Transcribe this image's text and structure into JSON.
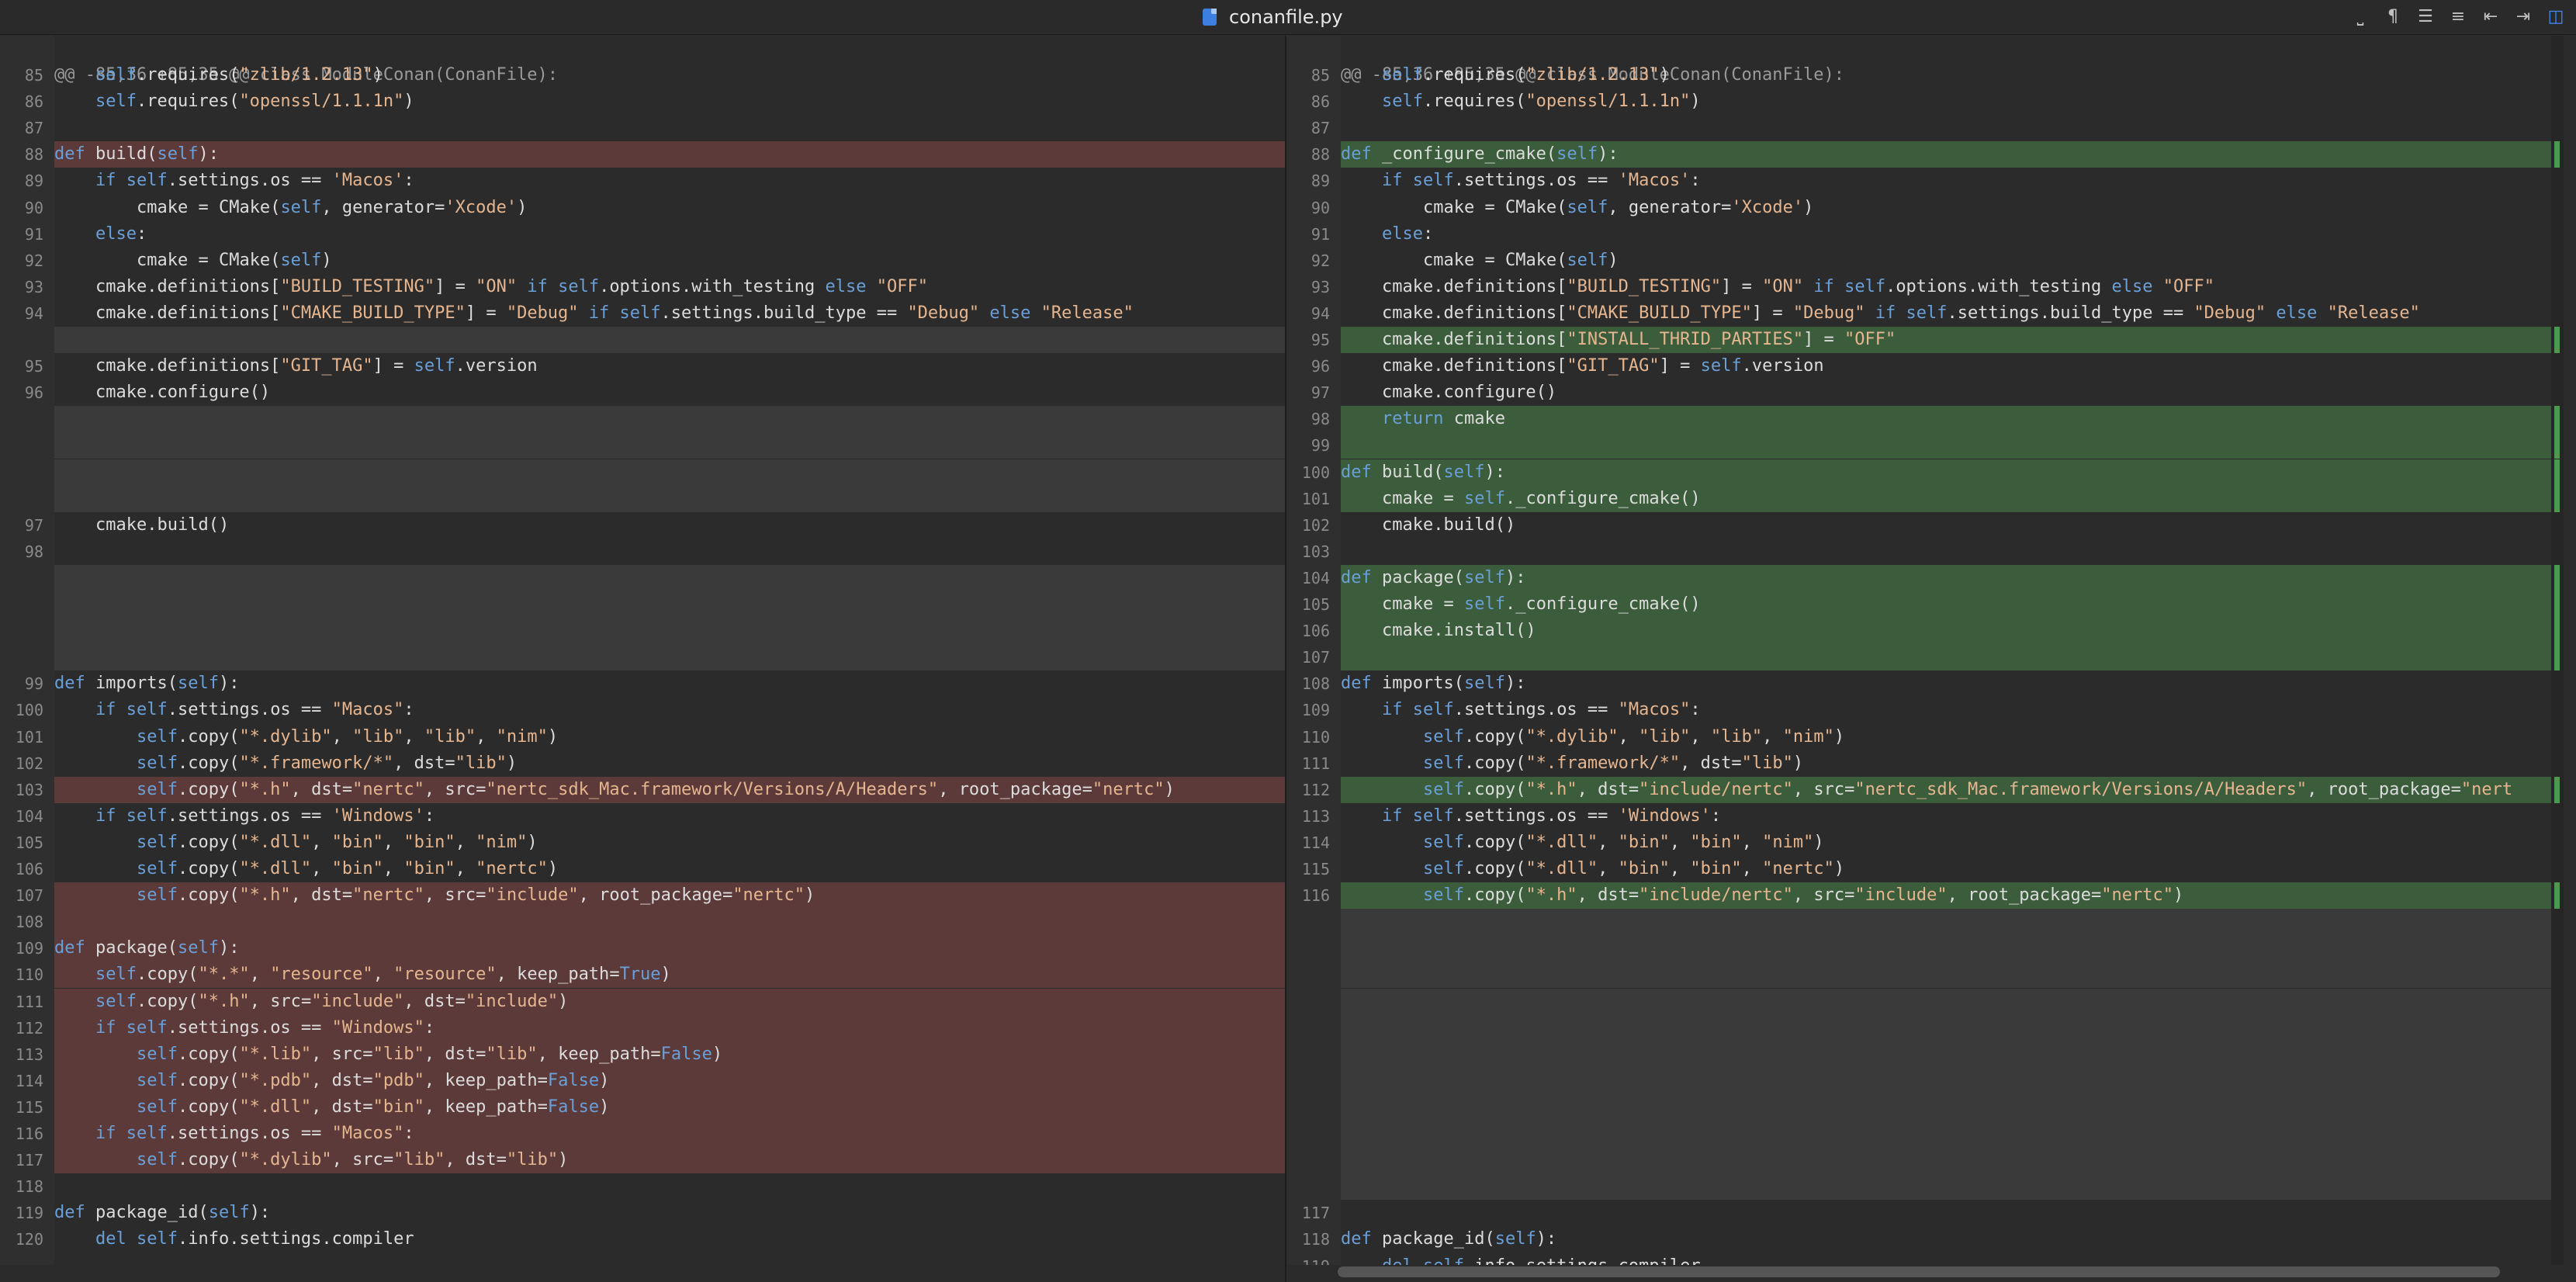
{
  "window": {
    "title": "conanfile.py",
    "file_icon": "python-file-icon"
  },
  "toolbar": {
    "icons": [
      "whitespace-icon",
      "pilcrow-icon",
      "align-left-icon",
      "align-center-icon",
      "indent-left-icon",
      "indent-right-icon",
      "split-view-icon"
    ],
    "glyphs": [
      "⎵",
      "¶",
      "☰",
      "≡",
      "⇤",
      "⇥",
      "◫"
    ]
  },
  "left": {
    "header": "@@ -85,36 +85,35 @@ class ModuleConan(ConanFile):",
    "rows": [
      {
        "ln": "85",
        "type": "",
        "text": "    self.requires(\"zlib/1.2.13\")"
      },
      {
        "ln": "86",
        "type": "",
        "text": "    self.requires(\"openssl/1.1.1n\")"
      },
      {
        "ln": "87",
        "type": "",
        "text": ""
      },
      {
        "ln": "88",
        "type": "del",
        "text": "def build(self):"
      },
      {
        "ln": "89",
        "type": "",
        "text": "    if self.settings.os == 'Macos':"
      },
      {
        "ln": "90",
        "type": "",
        "text": "        cmake = CMake(self, generator='Xcode')"
      },
      {
        "ln": "91",
        "type": "",
        "text": "    else:"
      },
      {
        "ln": "92",
        "type": "",
        "text": "        cmake = CMake(self)"
      },
      {
        "ln": "93",
        "type": "",
        "text": "    cmake.definitions[\"BUILD_TESTING\"] = \"ON\" if self.options.with_testing else \"OFF\""
      },
      {
        "ln": "94",
        "type": "",
        "text": "    cmake.definitions[\"CMAKE_BUILD_TYPE\"] = \"Debug\" if self.settings.build_type == \"Debug\" else \"Release\""
      },
      {
        "ln": "",
        "type": "empty",
        "text": ""
      },
      {
        "ln": "95",
        "type": "",
        "text": "    cmake.definitions[\"GIT_TAG\"] = self.version"
      },
      {
        "ln": "96",
        "type": "",
        "text": "    cmake.configure()"
      },
      {
        "ln": "",
        "type": "empty",
        "text": ""
      },
      {
        "ln": "",
        "type": "empty",
        "text": ""
      },
      {
        "ln": "",
        "type": "empty",
        "text": ""
      },
      {
        "ln": "",
        "type": "empty",
        "text": ""
      },
      {
        "ln": "97",
        "type": "",
        "text": "    cmake.build()"
      },
      {
        "ln": "98",
        "type": "",
        "text": ""
      },
      {
        "ln": "",
        "type": "empty",
        "text": ""
      },
      {
        "ln": "",
        "type": "empty",
        "text": ""
      },
      {
        "ln": "",
        "type": "empty",
        "text": ""
      },
      {
        "ln": "",
        "type": "empty",
        "text": ""
      },
      {
        "ln": "99",
        "type": "",
        "text": "def imports(self):"
      },
      {
        "ln": "100",
        "type": "",
        "text": "    if self.settings.os == \"Macos\":"
      },
      {
        "ln": "101",
        "type": "",
        "text": "        self.copy(\"*.dylib\", \"lib\", \"lib\", \"nim\")"
      },
      {
        "ln": "102",
        "type": "",
        "text": "        self.copy(\"*.framework/*\", dst=\"lib\")"
      },
      {
        "ln": "103",
        "type": "del",
        "text": "        self.copy(\"*.h\", dst=\"nertc\", src=\"nertc_sdk_Mac.framework/Versions/A/Headers\", root_package=\"nertc\")"
      },
      {
        "ln": "104",
        "type": "",
        "text": "    if self.settings.os == 'Windows':"
      },
      {
        "ln": "105",
        "type": "",
        "text": "        self.copy(\"*.dll\", \"bin\", \"bin\", \"nim\")"
      },
      {
        "ln": "106",
        "type": "",
        "text": "        self.copy(\"*.dll\", \"bin\", \"bin\", \"nertc\")"
      },
      {
        "ln": "107",
        "type": "del",
        "text": "        self.copy(\"*.h\", dst=\"nertc\", src=\"include\", root_package=\"nertc\")"
      },
      {
        "ln": "108",
        "type": "del",
        "text": ""
      },
      {
        "ln": "109",
        "type": "del",
        "text": "def package(self):"
      },
      {
        "ln": "110",
        "type": "del",
        "text": "    self.copy(\"*.*\", \"resource\", \"resource\", keep_path=True)"
      },
      {
        "ln": "111",
        "type": "del",
        "text": "    self.copy(\"*.h\", src=\"include\", dst=\"include\")"
      },
      {
        "ln": "112",
        "type": "del",
        "text": "    if self.settings.os == \"Windows\":"
      },
      {
        "ln": "113",
        "type": "del",
        "text": "        self.copy(\"*.lib\", src=\"lib\", dst=\"lib\", keep_path=False)"
      },
      {
        "ln": "114",
        "type": "del",
        "text": "        self.copy(\"*.pdb\", dst=\"pdb\", keep_path=False)"
      },
      {
        "ln": "115",
        "type": "del",
        "text": "        self.copy(\"*.dll\", dst=\"bin\", keep_path=False)"
      },
      {
        "ln": "116",
        "type": "del",
        "text": "    if self.settings.os == \"Macos\":"
      },
      {
        "ln": "117",
        "type": "del",
        "text": "        self.copy(\"*.dylib\", src=\"lib\", dst=\"lib\")"
      },
      {
        "ln": "118",
        "type": "",
        "text": ""
      },
      {
        "ln": "119",
        "type": "",
        "text": "def package_id(self):"
      },
      {
        "ln": "120",
        "type": "",
        "text": "    del self.info.settings.compiler"
      }
    ]
  },
  "right": {
    "header": "@@ -85,36 +85,35 @@ class ModuleConan(ConanFile):",
    "rows": [
      {
        "ln": "85",
        "type": "",
        "text": "    self.requires(\"zlib/1.2.13\")"
      },
      {
        "ln": "86",
        "type": "",
        "text": "    self.requires(\"openssl/1.1.1n\")"
      },
      {
        "ln": "87",
        "type": "",
        "text": ""
      },
      {
        "ln": "88",
        "type": "add",
        "text": "def _configure_cmake(self):"
      },
      {
        "ln": "89",
        "type": "",
        "text": "    if self.settings.os == 'Macos':"
      },
      {
        "ln": "90",
        "type": "",
        "text": "        cmake = CMake(self, generator='Xcode')"
      },
      {
        "ln": "91",
        "type": "",
        "text": "    else:"
      },
      {
        "ln": "92",
        "type": "",
        "text": "        cmake = CMake(self)"
      },
      {
        "ln": "93",
        "type": "",
        "text": "    cmake.definitions[\"BUILD_TESTING\"] = \"ON\" if self.options.with_testing else \"OFF\""
      },
      {
        "ln": "94",
        "type": "",
        "text": "    cmake.definitions[\"CMAKE_BUILD_TYPE\"] = \"Debug\" if self.settings.build_type == \"Debug\" else \"Release\""
      },
      {
        "ln": "95",
        "type": "add",
        "text": "    cmake.definitions[\"INSTALL_THRID_PARTIES\"] = \"OFF\""
      },
      {
        "ln": "96",
        "type": "",
        "text": "    cmake.definitions[\"GIT_TAG\"] = self.version"
      },
      {
        "ln": "97",
        "type": "",
        "text": "    cmake.configure()"
      },
      {
        "ln": "98",
        "type": "add",
        "text": "    return cmake"
      },
      {
        "ln": "99",
        "type": "add",
        "text": ""
      },
      {
        "ln": "100",
        "type": "add",
        "text": "def build(self):"
      },
      {
        "ln": "101",
        "type": "add",
        "text": "    cmake = self._configure_cmake()"
      },
      {
        "ln": "102",
        "type": "",
        "text": "    cmake.build()"
      },
      {
        "ln": "103",
        "type": "",
        "text": ""
      },
      {
        "ln": "104",
        "type": "add",
        "text": "def package(self):"
      },
      {
        "ln": "105",
        "type": "add",
        "text": "    cmake = self._configure_cmake()"
      },
      {
        "ln": "106",
        "type": "add",
        "text": "    cmake.install()"
      },
      {
        "ln": "107",
        "type": "add",
        "text": ""
      },
      {
        "ln": "108",
        "type": "",
        "text": "def imports(self):"
      },
      {
        "ln": "109",
        "type": "",
        "text": "    if self.settings.os == \"Macos\":"
      },
      {
        "ln": "110",
        "type": "",
        "text": "        self.copy(\"*.dylib\", \"lib\", \"lib\", \"nim\")"
      },
      {
        "ln": "111",
        "type": "",
        "text": "        self.copy(\"*.framework/*\", dst=\"lib\")"
      },
      {
        "ln": "112",
        "type": "add",
        "text": "        self.copy(\"*.h\", dst=\"include/nertc\", src=\"nertc_sdk_Mac.framework/Versions/A/Headers\", root_package=\"nert"
      },
      {
        "ln": "113",
        "type": "",
        "text": "    if self.settings.os == 'Windows':"
      },
      {
        "ln": "114",
        "type": "",
        "text": "        self.copy(\"*.dll\", \"bin\", \"bin\", \"nim\")"
      },
      {
        "ln": "115",
        "type": "",
        "text": "        self.copy(\"*.dll\", \"bin\", \"bin\", \"nertc\")"
      },
      {
        "ln": "116",
        "type": "add",
        "text": "        self.copy(\"*.h\", dst=\"include/nertc\", src=\"include\", root_package=\"nertc\")"
      },
      {
        "ln": "",
        "type": "empty",
        "text": ""
      },
      {
        "ln": "",
        "type": "empty",
        "text": ""
      },
      {
        "ln": "",
        "type": "empty",
        "text": ""
      },
      {
        "ln": "",
        "type": "empty",
        "text": ""
      },
      {
        "ln": "",
        "type": "empty",
        "text": ""
      },
      {
        "ln": "",
        "type": "empty",
        "text": ""
      },
      {
        "ln": "",
        "type": "empty",
        "text": ""
      },
      {
        "ln": "",
        "type": "empty",
        "text": ""
      },
      {
        "ln": "",
        "type": "empty",
        "text": ""
      },
      {
        "ln": "",
        "type": "empty",
        "text": ""
      },
      {
        "ln": "",
        "type": "empty",
        "text": ""
      },
      {
        "ln": "117",
        "type": "",
        "text": ""
      },
      {
        "ln": "118",
        "type": "",
        "text": "def package_id(self):"
      },
      {
        "ln": "119",
        "type": "",
        "text": "    del self.info.settings.compiler"
      }
    ]
  },
  "colors": {
    "deleted": "#5c3a39",
    "added": "#3b5d3b",
    "keyword": "#6a9fd8",
    "string": "#e5b58f"
  }
}
